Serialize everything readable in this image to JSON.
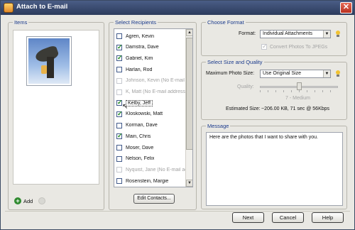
{
  "window": {
    "title": "Attach to E-mail"
  },
  "items": {
    "label": "Items",
    "add_label": "Add"
  },
  "recipients": {
    "label": "Select Recipients",
    "list": [
      {
        "name": "Agren, Kevin",
        "checked": false,
        "disabled": false
      },
      {
        "name": "Damstra, Dave",
        "checked": true,
        "disabled": false
      },
      {
        "name": "Gabriel, Kim",
        "checked": true,
        "disabled": false
      },
      {
        "name": "Harlan, Rod",
        "checked": false,
        "disabled": false
      },
      {
        "name": "Johnson, Kevin (No E-mail",
        "checked": false,
        "disabled": true
      },
      {
        "name": "K, Matt (No E-mail address)",
        "checked": false,
        "disabled": true
      },
      {
        "name": "Kelby, Jeff",
        "checked": true,
        "disabled": false,
        "focused": true
      },
      {
        "name": "Kloskowski, Matt",
        "checked": true,
        "disabled": false
      },
      {
        "name": "Korman, Dave",
        "checked": false,
        "disabled": false
      },
      {
        "name": "Main, Chris",
        "checked": true,
        "disabled": false
      },
      {
        "name": "Moser, Dave",
        "checked": false,
        "disabled": false
      },
      {
        "name": "Nelson, Felix",
        "checked": false,
        "disabled": false
      },
      {
        "name": "Nyquist, Jane (No E-mail ac",
        "checked": false,
        "disabled": true
      },
      {
        "name": "Rosenstein, Margie",
        "checked": false,
        "disabled": false
      }
    ],
    "edit_contacts_label": "Edit Contacts..."
  },
  "format": {
    "label": "Choose Format",
    "field_label": "Format:",
    "value": "Individual Attachments",
    "convert_label": "Convert Photos To JPEGs"
  },
  "size": {
    "label": "Select Size and Quality",
    "max_size_label": "Maximum Photo Size:",
    "max_size_value": "Use Original Size",
    "quality_label": "Quality:",
    "quality_value_text": "7 - Medium",
    "quality_level": 0.5,
    "estimated_label": "Estimated Size:",
    "estimated_value": "~206.00 KB, 71 sec @ 56Kbps"
  },
  "message": {
    "label": "Message",
    "text": "Here are the photos that I want to share with you."
  },
  "footer": {
    "next": "Next",
    "cancel": "Cancel",
    "help": "Help"
  }
}
